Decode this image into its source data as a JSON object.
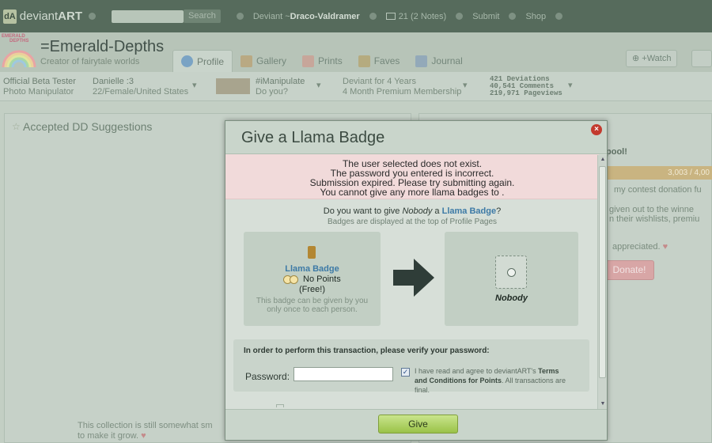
{
  "topbar": {
    "logo_text_light": "deviant",
    "logo_text_bold": "ART",
    "search_button": "Search",
    "deviant_label": "Deviant",
    "deviant_name": "Draco-Valdramer",
    "notes": "21 (2 Notes)",
    "submit": "Submit",
    "shop": "Shop"
  },
  "header": {
    "logo_lines": [
      "EMERALD",
      "DEPTHS"
    ],
    "username": "=Emerald-Depths",
    "tagline": "Creator of fairytale worlds",
    "tabs": [
      {
        "label": "Profile",
        "active": true
      },
      {
        "label": "Gallery",
        "active": false
      },
      {
        "label": "Prints",
        "active": false
      },
      {
        "label": "Faves",
        "active": false
      },
      {
        "label": "Journal",
        "active": false
      }
    ],
    "watch_button": "+Watch"
  },
  "info": {
    "role_title": "Official Beta Tester",
    "role_sub": "Photo Manipulator",
    "person_title": "Danielle :3",
    "person_sub": "22/Female/United States",
    "group_title": "#iManipulate",
    "group_sub": "Do you?",
    "member_title": "Deviant for 4 Years",
    "member_sub": "4 Month Premium Membership",
    "stats": [
      "421 Deviations",
      "40,541 Comments",
      "219,971 Pageviews"
    ]
  },
  "left_panel": {
    "title": "Accepted DD Suggestions",
    "footer_line1": "This collection is still somewhat sm",
    "footer_line2": "to make it grow."
  },
  "right_panel": {
    "heading": "pool!",
    "bar_text": "3,003 / 4,00",
    "line1": "my contest donation fu",
    "line2": "given out to the winne",
    "line3": "n their wishlists, premiu",
    "line4": "appreciated.",
    "donate": "Donate!"
  },
  "modal": {
    "title": "Give a Llama Badge",
    "close": "×",
    "errors": [
      "The user selected does not exist.",
      "The password you entered is incorrect.",
      "Submission expired. Please try submitting again.",
      "You cannot give any more llama badges to ."
    ],
    "question_prefix": "Do you want to give ",
    "question_user": "Nobody",
    "question_mid": " a ",
    "question_badge": "Llama Badge",
    "question_suffix": "?",
    "subtitle": "Badges are displayed at the top of Profile Pages",
    "badge_name": "Llama Badge",
    "badge_points": "No Points",
    "badge_free": "(Free!)",
    "badge_desc": "This badge can be given by you only once to each person.",
    "recipient": "Nobody",
    "verify_title": "In order to perform this transaction, please verify your password:",
    "password_label": "Password:",
    "password_value": "",
    "agree_prefix": "I have read and agree to deviantART's ",
    "agree_link": "Terms and Conditions for Points",
    "agree_suffix": ". All transactions are final.",
    "agree_checked": "✓",
    "give_button": "Give"
  },
  "colors": {
    "accent_link": "#3d7aa6",
    "error_bg": "#f1dada",
    "close_red": "#c33a2e",
    "give_green": "#9ac248"
  }
}
